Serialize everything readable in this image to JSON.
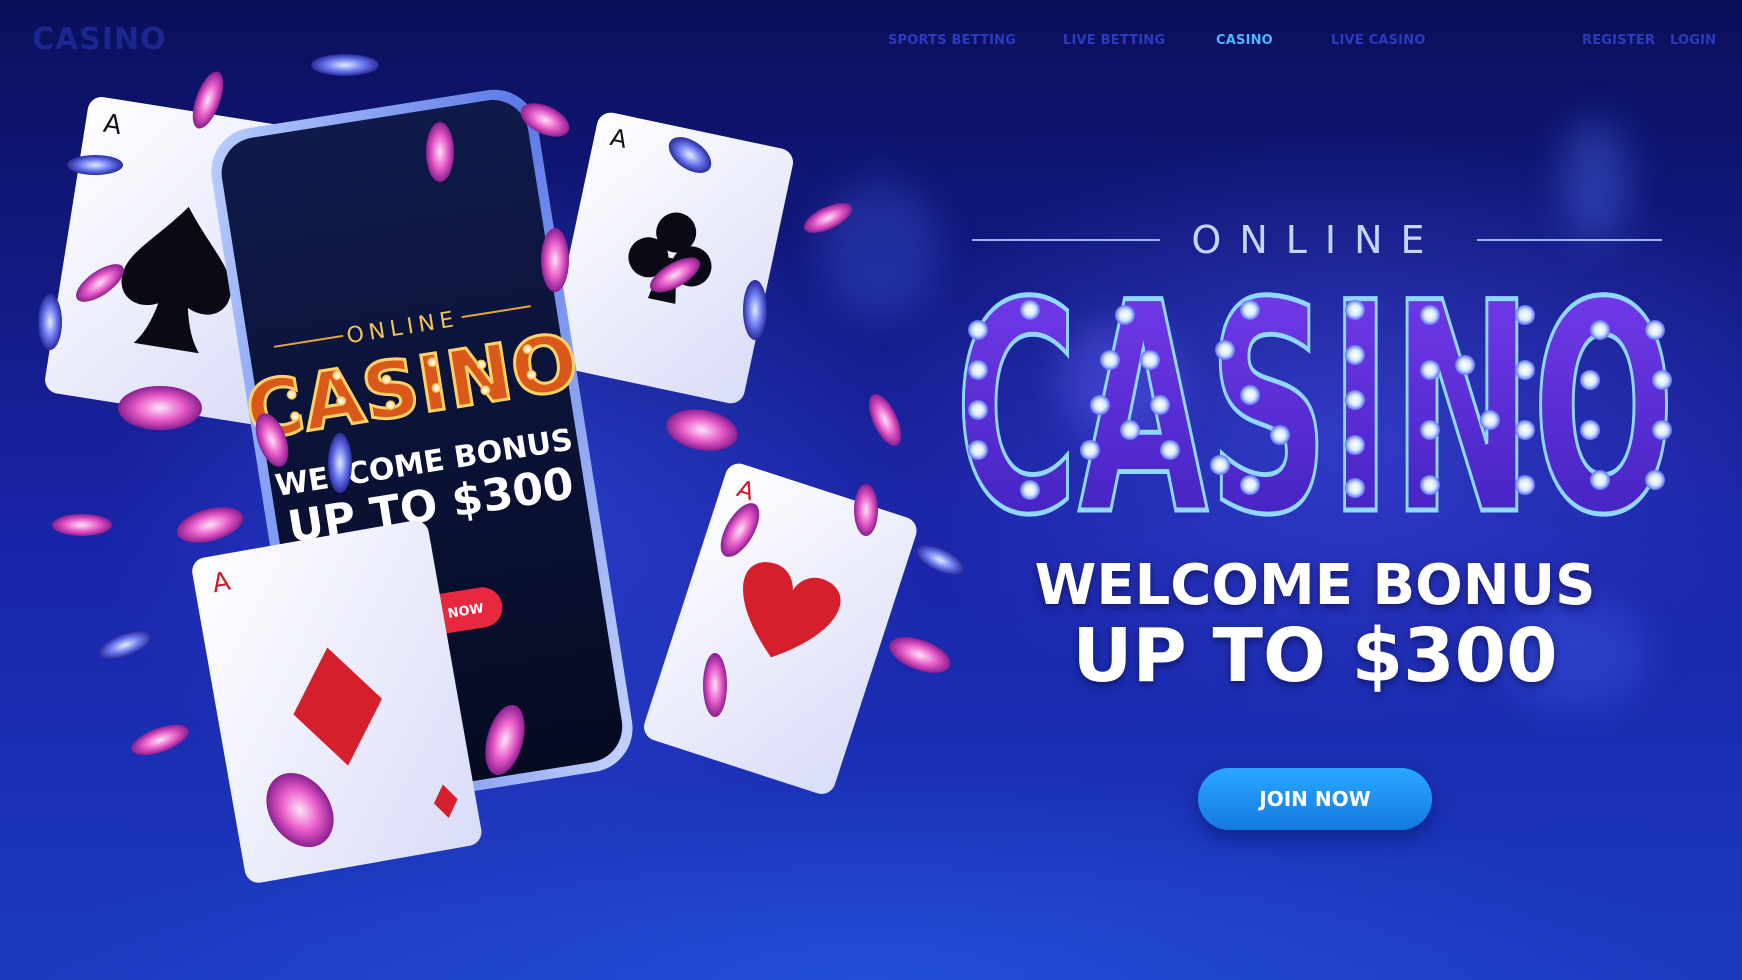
{
  "nav": {
    "logo": "CASINO",
    "links": [
      {
        "label": "SPORTS BETTING",
        "active": false
      },
      {
        "label": "LIVE BETTING",
        "active": false
      },
      {
        "label": "CASINO",
        "active": true
      },
      {
        "label": "LIVE CASINO",
        "active": false
      }
    ],
    "register": "REGISTER",
    "login": "LOGIN"
  },
  "hero": {
    "online": "ONLINE",
    "title": "CASINO",
    "bonus_line1": "WELCOME BONUS",
    "bonus_line2": "UP TO $300",
    "cta": "JOIN NOW"
  },
  "phone": {
    "online": "ONLINE",
    "title": "CASINO",
    "bonus_line1": "WELCOME BONUS",
    "bonus_line2": "UP TO $300",
    "cta": "JOIN NOW"
  },
  "cards": [
    "A",
    "A",
    "A",
    "A"
  ],
  "colors": {
    "background": "#1a24a8",
    "accent_button": "#2aa8ff",
    "phone_button": "#e8283f",
    "marquee_letters": "#5b2de0",
    "phone_marquee": "#e0641a"
  }
}
